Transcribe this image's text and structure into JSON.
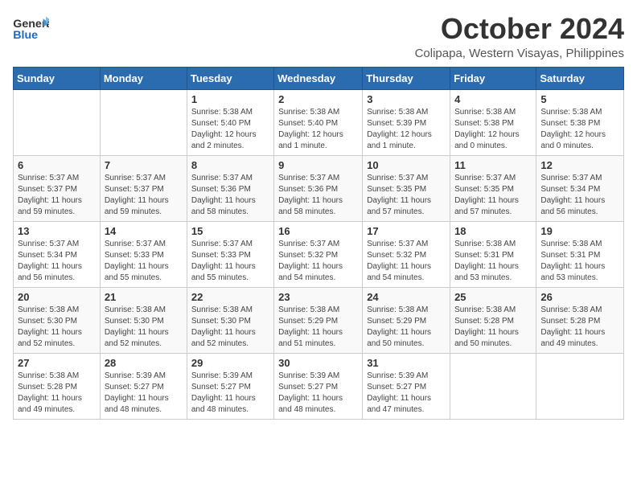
{
  "header": {
    "logo_general": "General",
    "logo_blue": "Blue",
    "month": "October 2024",
    "location": "Colipapa, Western Visayas, Philippines"
  },
  "weekdays": [
    "Sunday",
    "Monday",
    "Tuesday",
    "Wednesday",
    "Thursday",
    "Friday",
    "Saturday"
  ],
  "weeks": [
    [
      {
        "day": "",
        "info": ""
      },
      {
        "day": "",
        "info": ""
      },
      {
        "day": "1",
        "sunrise": "Sunrise: 5:38 AM",
        "sunset": "Sunset: 5:40 PM",
        "daylight": "Daylight: 12 hours and 2 minutes."
      },
      {
        "day": "2",
        "sunrise": "Sunrise: 5:38 AM",
        "sunset": "Sunset: 5:40 PM",
        "daylight": "Daylight: 12 hours and 1 minute."
      },
      {
        "day": "3",
        "sunrise": "Sunrise: 5:38 AM",
        "sunset": "Sunset: 5:39 PM",
        "daylight": "Daylight: 12 hours and 1 minute."
      },
      {
        "day": "4",
        "sunrise": "Sunrise: 5:38 AM",
        "sunset": "Sunset: 5:38 PM",
        "daylight": "Daylight: 12 hours and 0 minutes."
      },
      {
        "day": "5",
        "sunrise": "Sunrise: 5:38 AM",
        "sunset": "Sunset: 5:38 PM",
        "daylight": "Daylight: 12 hours and 0 minutes."
      }
    ],
    [
      {
        "day": "6",
        "sunrise": "Sunrise: 5:37 AM",
        "sunset": "Sunset: 5:37 PM",
        "daylight": "Daylight: 11 hours and 59 minutes."
      },
      {
        "day": "7",
        "sunrise": "Sunrise: 5:37 AM",
        "sunset": "Sunset: 5:37 PM",
        "daylight": "Daylight: 11 hours and 59 minutes."
      },
      {
        "day": "8",
        "sunrise": "Sunrise: 5:37 AM",
        "sunset": "Sunset: 5:36 PM",
        "daylight": "Daylight: 11 hours and 58 minutes."
      },
      {
        "day": "9",
        "sunrise": "Sunrise: 5:37 AM",
        "sunset": "Sunset: 5:36 PM",
        "daylight": "Daylight: 11 hours and 58 minutes."
      },
      {
        "day": "10",
        "sunrise": "Sunrise: 5:37 AM",
        "sunset": "Sunset: 5:35 PM",
        "daylight": "Daylight: 11 hours and 57 minutes."
      },
      {
        "day": "11",
        "sunrise": "Sunrise: 5:37 AM",
        "sunset": "Sunset: 5:35 PM",
        "daylight": "Daylight: 11 hours and 57 minutes."
      },
      {
        "day": "12",
        "sunrise": "Sunrise: 5:37 AM",
        "sunset": "Sunset: 5:34 PM",
        "daylight": "Daylight: 11 hours and 56 minutes."
      }
    ],
    [
      {
        "day": "13",
        "sunrise": "Sunrise: 5:37 AM",
        "sunset": "Sunset: 5:34 PM",
        "daylight": "Daylight: 11 hours and 56 minutes."
      },
      {
        "day": "14",
        "sunrise": "Sunrise: 5:37 AM",
        "sunset": "Sunset: 5:33 PM",
        "daylight": "Daylight: 11 hours and 55 minutes."
      },
      {
        "day": "15",
        "sunrise": "Sunrise: 5:37 AM",
        "sunset": "Sunset: 5:33 PM",
        "daylight": "Daylight: 11 hours and 55 minutes."
      },
      {
        "day": "16",
        "sunrise": "Sunrise: 5:37 AM",
        "sunset": "Sunset: 5:32 PM",
        "daylight": "Daylight: 11 hours and 54 minutes."
      },
      {
        "day": "17",
        "sunrise": "Sunrise: 5:37 AM",
        "sunset": "Sunset: 5:32 PM",
        "daylight": "Daylight: 11 hours and 54 minutes."
      },
      {
        "day": "18",
        "sunrise": "Sunrise: 5:38 AM",
        "sunset": "Sunset: 5:31 PM",
        "daylight": "Daylight: 11 hours and 53 minutes."
      },
      {
        "day": "19",
        "sunrise": "Sunrise: 5:38 AM",
        "sunset": "Sunset: 5:31 PM",
        "daylight": "Daylight: 11 hours and 53 minutes."
      }
    ],
    [
      {
        "day": "20",
        "sunrise": "Sunrise: 5:38 AM",
        "sunset": "Sunset: 5:30 PM",
        "daylight": "Daylight: 11 hours and 52 minutes."
      },
      {
        "day": "21",
        "sunrise": "Sunrise: 5:38 AM",
        "sunset": "Sunset: 5:30 PM",
        "daylight": "Daylight: 11 hours and 52 minutes."
      },
      {
        "day": "22",
        "sunrise": "Sunrise: 5:38 AM",
        "sunset": "Sunset: 5:30 PM",
        "daylight": "Daylight: 11 hours and 52 minutes."
      },
      {
        "day": "23",
        "sunrise": "Sunrise: 5:38 AM",
        "sunset": "Sunset: 5:29 PM",
        "daylight": "Daylight: 11 hours and 51 minutes."
      },
      {
        "day": "24",
        "sunrise": "Sunrise: 5:38 AM",
        "sunset": "Sunset: 5:29 PM",
        "daylight": "Daylight: 11 hours and 50 minutes."
      },
      {
        "day": "25",
        "sunrise": "Sunrise: 5:38 AM",
        "sunset": "Sunset: 5:28 PM",
        "daylight": "Daylight: 11 hours and 50 minutes."
      },
      {
        "day": "26",
        "sunrise": "Sunrise: 5:38 AM",
        "sunset": "Sunset: 5:28 PM",
        "daylight": "Daylight: 11 hours and 49 minutes."
      }
    ],
    [
      {
        "day": "27",
        "sunrise": "Sunrise: 5:38 AM",
        "sunset": "Sunset: 5:28 PM",
        "daylight": "Daylight: 11 hours and 49 minutes."
      },
      {
        "day": "28",
        "sunrise": "Sunrise: 5:39 AM",
        "sunset": "Sunset: 5:27 PM",
        "daylight": "Daylight: 11 hours and 48 minutes."
      },
      {
        "day": "29",
        "sunrise": "Sunrise: 5:39 AM",
        "sunset": "Sunset: 5:27 PM",
        "daylight": "Daylight: 11 hours and 48 minutes."
      },
      {
        "day": "30",
        "sunrise": "Sunrise: 5:39 AM",
        "sunset": "Sunset: 5:27 PM",
        "daylight": "Daylight: 11 hours and 48 minutes."
      },
      {
        "day": "31",
        "sunrise": "Sunrise: 5:39 AM",
        "sunset": "Sunset: 5:27 PM",
        "daylight": "Daylight: 11 hours and 47 minutes."
      },
      {
        "day": "",
        "info": ""
      },
      {
        "day": "",
        "info": ""
      }
    ]
  ]
}
